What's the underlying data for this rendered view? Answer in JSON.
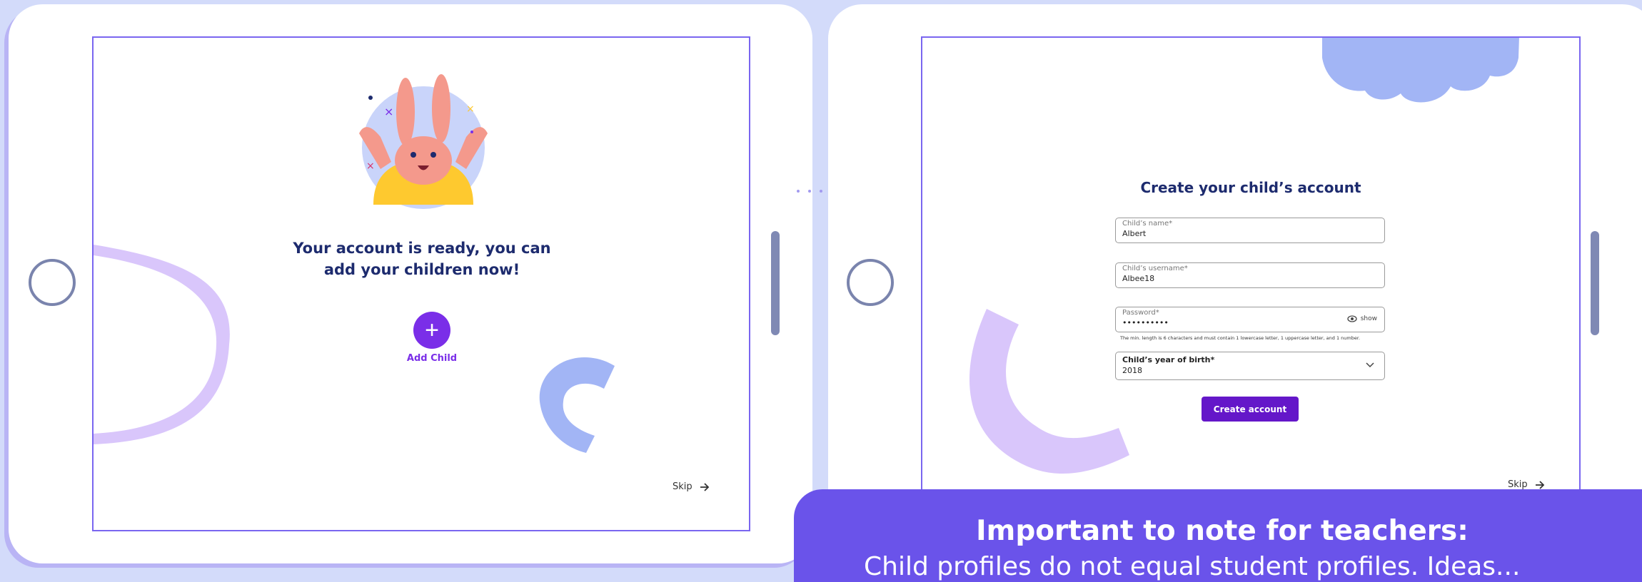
{
  "colors": {
    "background": "#d3dbfa",
    "accent_purple": "#7a2ee8",
    "button_purple": "#6417c9",
    "heading_navy": "#1d2b6e",
    "note_panel": "#6a53ea",
    "screen_border": "#7a66f0"
  },
  "screen_left": {
    "illustration": "bunny-celebration-illustration",
    "message": "Your account is ready, you can add your children now!",
    "add_child_icon": "plus-icon",
    "add_child_label": "Add Child",
    "skip_label": "Skip",
    "skip_icon": "arrow-right-icon"
  },
  "flow_connector": "dotted-arrow-right-icon",
  "screen_right": {
    "title": "Create your child’s account",
    "fields": {
      "name": {
        "label": "Child’s name*",
        "value": "Albert"
      },
      "username": {
        "label": "Child’s username*",
        "value": "Albee18"
      },
      "password": {
        "label": "Password*",
        "value": "••••••••••",
        "toggle_label": "show",
        "toggle_icon": "eye-icon"
      },
      "year": {
        "label": "Child’s year of birth*",
        "value": "2018",
        "icon": "chevron-down-icon"
      }
    },
    "password_hint": "The min. length is 6 characters and must contain 1 lowercase letter, 1 uppercase letter, and 1 number.",
    "create_button": "Create account",
    "skip_label": "Skip",
    "skip_icon": "arrow-right-icon"
  },
  "note": {
    "title": "Important to note for teachers:",
    "body": "Child profiles do not equal student profiles. Ideas..."
  }
}
